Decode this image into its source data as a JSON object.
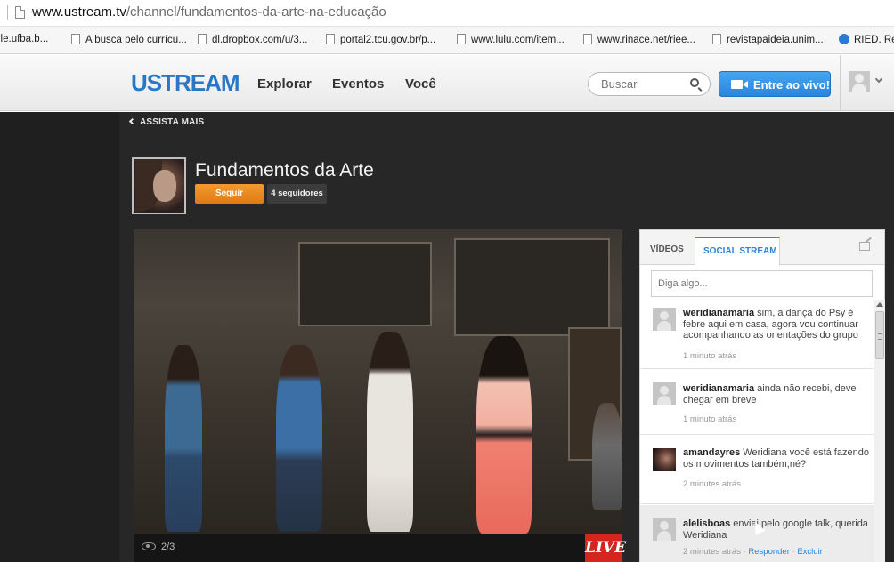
{
  "browser": {
    "url_host": "www.ustream.tv",
    "url_path": "/channel/fundamentos-da-arte-na-educação",
    "bookmarks": [
      "lle.ufba.b...",
      "A busca pelo currícu...",
      "dl.dropbox.com/u/3...",
      "portal2.tcu.gov.br/p...",
      "www.lulu.com/item...",
      "www.rinace.net/riee...",
      "revistapaideia.unim...",
      "RIED. Rev"
    ]
  },
  "header": {
    "logo": "USTREAM",
    "nav": [
      "Explorar",
      "Eventos",
      "Você"
    ],
    "search_placeholder": "Buscar",
    "live_button": "Entre ao vivo!",
    "accent_color": "#2a84d8"
  },
  "channel": {
    "back_link": "ASSISTA MAIS",
    "title": "Fundamentos da Arte",
    "follow_button": "Seguir",
    "followers": "4 seguidores"
  },
  "video": {
    "view_count": "2/3",
    "live_badge": "LIVE",
    "live_color": "#d6241e"
  },
  "social": {
    "tabs": [
      "VÍDEOS",
      "SOCIAL STREAM"
    ],
    "active_tab": "SOCIAL STREAM",
    "input_placeholder": "Diga algo...",
    "messages": [
      {
        "user": "weridianamaria",
        "text": " sim, a dança do Psy é febre aqui em casa, agora vou continuar acompanhando as orientações do grupo",
        "time": "1 minuto atrás"
      },
      {
        "user": "weridianamaria",
        "text": " ainda não recebi, deve chegar em breve",
        "time": "1 minuto atrás"
      },
      {
        "user": "amandayres",
        "text": " Weridiana você está fazendo os movimentos também,né?",
        "time": "2 minutes atrás"
      },
      {
        "user": "alelisboas",
        "text": " enviei pelo google talk, querida Weridiana",
        "time": "2 minutes atrás",
        "separator": "·",
        "reply": "Responder",
        "delete": "Excluir"
      }
    ]
  }
}
